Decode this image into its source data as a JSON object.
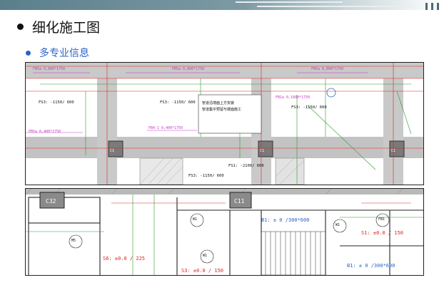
{
  "slide": {
    "title": "细化施工图",
    "subtitle": "多专业信息"
  },
  "drawing_top": {
    "beam_labels": [
      "FB5a 0,800*1750",
      "FB5a 0,800*1750",
      "FB5a 0,800*1750",
      "FB5a 0,400*1750",
      "FB4-1 0,400*1750",
      "FB1a 0,1600*1750"
    ],
    "slab_labels": [
      "FS3: -1150/ 600",
      "FS3: -1150/ 600",
      "FS3: -1150/ 600",
      "FS3: -1150/ 600",
      "FS1: -2100/ 600"
    ],
    "column_labels": [
      "C1",
      "C1",
      "C1"
    ],
    "note_line1": "管道沿墙面上方安装",
    "note_line2": "管道集中预留与楼面施工"
  },
  "drawing_bottom": {
    "column_tags": [
      "C32",
      "C11"
    ],
    "room_labels": [
      "S6: ±0.0 / 225",
      "S3: ±0.0 / 150",
      "S1: ±0.0 / 150",
      "B1: ± 0 /300*600",
      "B1: ± 0 /300*600"
    ],
    "door_tags": [
      "W1",
      "M5",
      "W1",
      "FB1",
      "W1"
    ]
  }
}
